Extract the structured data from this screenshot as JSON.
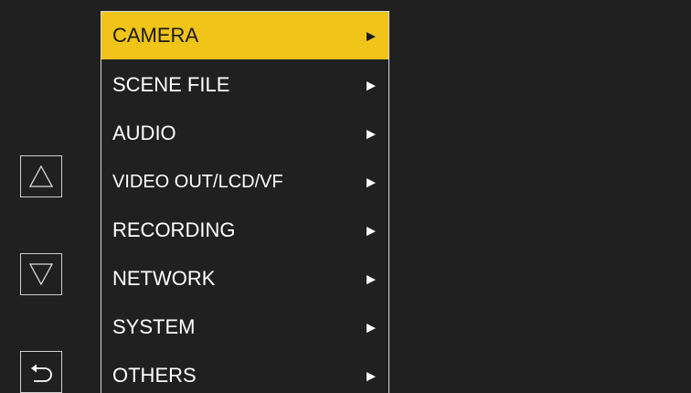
{
  "menu": {
    "items": [
      {
        "label": "CAMERA",
        "arrow": "▶",
        "active": true
      },
      {
        "label": "SCENE FILE",
        "arrow": "▶",
        "active": false
      },
      {
        "label": "AUDIO",
        "arrow": "▶",
        "active": false
      },
      {
        "label": "VIDEO OUT/LCD/VF",
        "arrow": "▶",
        "active": false
      },
      {
        "label": "RECORDING",
        "arrow": "▶",
        "active": false
      },
      {
        "label": "NETWORK",
        "arrow": "▶",
        "active": false
      },
      {
        "label": "SYSTEM",
        "arrow": "▶",
        "active": false
      },
      {
        "label": "OTHERS",
        "arrow": "▶",
        "active": false
      }
    ]
  },
  "side_buttons": {
    "up": {
      "icon": "up-triangle-icon"
    },
    "down": {
      "icon": "down-triangle-icon"
    },
    "back": {
      "icon": "return-arrow-icon"
    }
  },
  "colors": {
    "background": "#202020",
    "highlight": "#f0c419",
    "text": "#ffffff",
    "border": "#d8d8d8"
  }
}
